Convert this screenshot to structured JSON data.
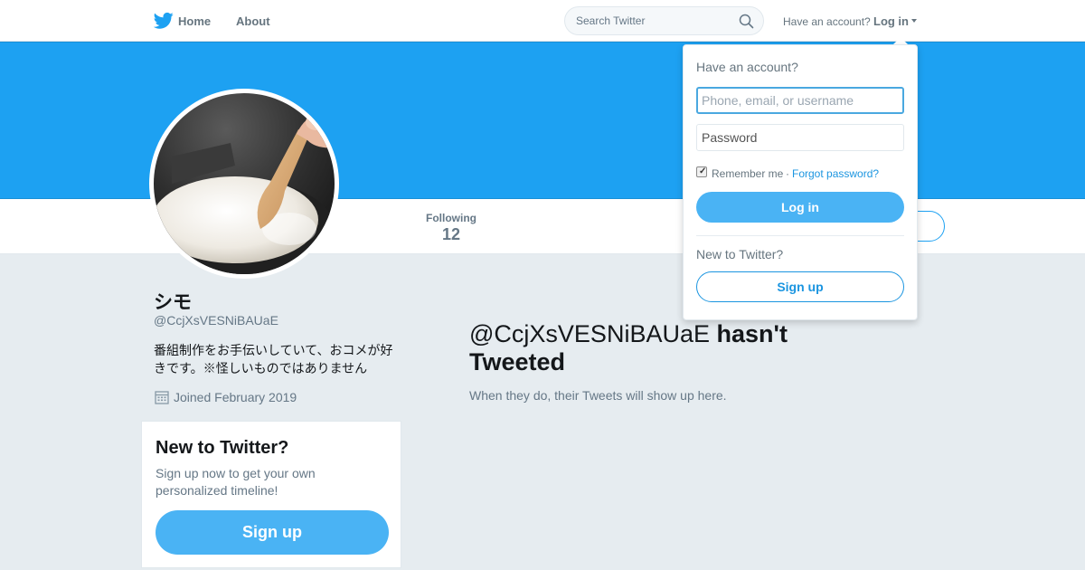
{
  "nav": {
    "logo_icon": "twitter-bird-icon",
    "home_label": "Home",
    "about_label": "About",
    "search_placeholder": "Search Twitter",
    "search_icon": "search-icon",
    "have_account": "Have an account?",
    "login_label": "Log in"
  },
  "colors": {
    "brand": "#1da1f2",
    "button": "#4ab3f4",
    "link": "#1b95e0",
    "background": "#e6ecf0"
  },
  "profile": {
    "name": "シモ",
    "handle": "@CcjXsVESNiBAUaE",
    "bio": "番組制作をお手伝いしていて、おコメが好きです。※怪しいものではありません",
    "joined": "Joined February 2019",
    "joined_icon": "calendar-icon",
    "following_label": "Following",
    "following_count": "12",
    "avatar_icon": "rice-avatar"
  },
  "signup_card": {
    "title": "New to Twitter?",
    "text": "Sign up now to get your own personalized timeline!",
    "button": "Sign up"
  },
  "timeline": {
    "empty_handle": "@CcjXsVESNiBAUaE",
    "empty_suffix": "hasn't Tweeted",
    "empty_sub": "When they do, their Tweets will show up here."
  },
  "login_dropdown": {
    "title": "Have an account?",
    "username_placeholder": "Phone, email, or username",
    "password_placeholder": "Password",
    "remember": "Remember me",
    "separator": "·",
    "forgot": "Forgot password?",
    "login_button": "Log in",
    "new_to_twitter": "New to Twitter?",
    "signup_button": "Sign up"
  }
}
